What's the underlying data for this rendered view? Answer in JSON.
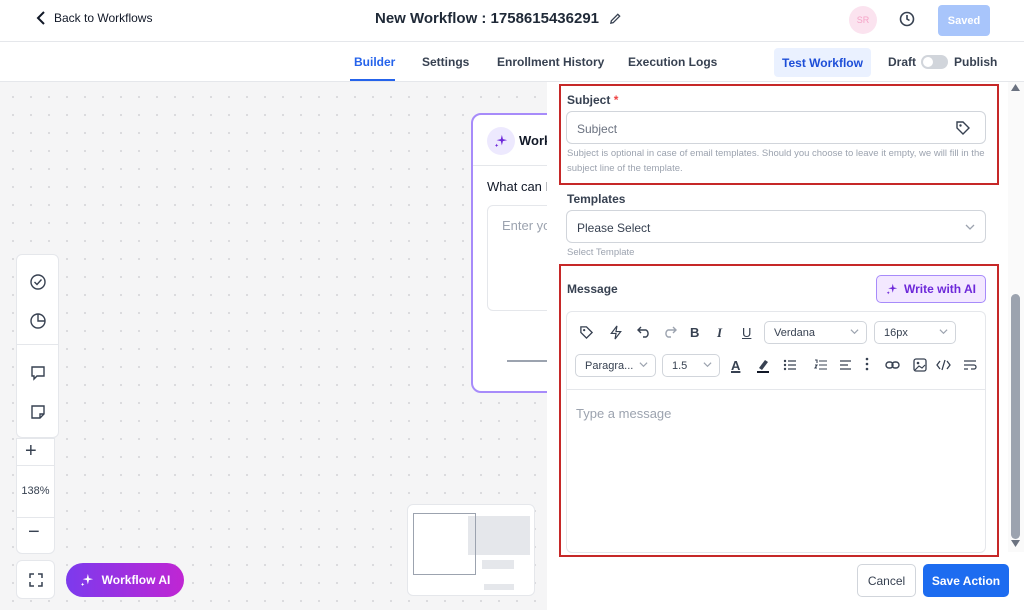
{
  "header": {
    "back_label": "Back to Workflows",
    "workflow_title": "New Workflow : 1758615436291",
    "avatar_initials": "SR",
    "saved_label": "Saved"
  },
  "tabs": [
    {
      "label": "Builder",
      "active": true
    },
    {
      "label": "Settings",
      "active": false
    },
    {
      "label": "Enrollment History",
      "active": false
    },
    {
      "label": "Execution Logs",
      "active": false
    }
  ],
  "actions": {
    "test_workflow_label": "Test Workflow",
    "draft_label": "Draft",
    "publish_label": "Publish",
    "published": false
  },
  "canvas": {
    "ai_card": {
      "title": "Workflow AI",
      "question": "What can I help you with?",
      "input_placeholder": "Enter your request"
    },
    "zoom_level": "138%",
    "workflow_ai_button": "Workflow AI",
    "tools": [
      "check-circle-icon",
      "pie-chart-icon",
      "comment-icon",
      "sticky-note-icon"
    ]
  },
  "panel": {
    "subject_label": "Subject",
    "subject_required_mark": "*",
    "subject_placeholder": "Subject",
    "subject_help": "Subject is optional in case of email templates. Should you choose to leave it empty, we will fill in the subject line of the template.",
    "templates_label": "Templates",
    "templates_selected": "Please Select",
    "templates_help": "Select Template",
    "message_label": "Message",
    "write_ai_label": "Write with AI",
    "editor": {
      "font": "Verdana",
      "size": "16px",
      "block": "Paragra...",
      "line_height": "1.5",
      "bold_glyph": "B",
      "italic_glyph": "I",
      "underline_glyph": "U",
      "color_glyph": "A",
      "message_placeholder": "Type a message"
    },
    "cancel_label": "Cancel",
    "save_label": "Save Action"
  },
  "colors": {
    "accent": "#2563eb",
    "highlight_box": "#c62828",
    "ai_gradient_start": "#7c3aed",
    "ai_gradient_end": "#c026d3"
  }
}
